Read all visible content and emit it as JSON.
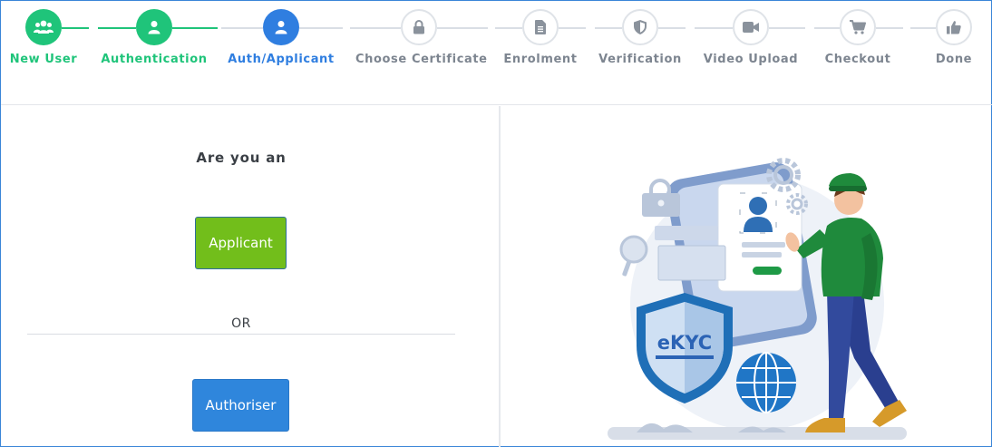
{
  "stepper": {
    "steps": [
      {
        "label": "New User",
        "state": "done",
        "icon": "users-icon"
      },
      {
        "label": "Authentication",
        "state": "done",
        "icon": "user-icon"
      },
      {
        "label": "Auth/Applicant",
        "state": "active",
        "icon": "user-icon"
      },
      {
        "label": "Choose Certificate",
        "state": "pending",
        "icon": "lock-icon"
      },
      {
        "label": "Enrolment",
        "state": "pending",
        "icon": "document-icon"
      },
      {
        "label": "Verification",
        "state": "pending",
        "icon": "shield-icon"
      },
      {
        "label": "Video Upload",
        "state": "pending",
        "icon": "video-camera-icon"
      },
      {
        "label": "Checkout",
        "state": "pending",
        "icon": "cart-icon"
      },
      {
        "label": "Done",
        "state": "pending",
        "icon": "thumbs-up-icon"
      }
    ]
  },
  "role_select": {
    "question": "Are you an",
    "applicant_label": "Applicant",
    "or_label": "OR",
    "authoriser_label": "Authoriser"
  },
  "illustration": {
    "badge_text": "eKYC"
  },
  "colors": {
    "done": "#1fc47a",
    "active": "#2f7ee0",
    "pending_text": "#7d8590",
    "applicant_button": "#72be1b",
    "authoriser_button": "#2f86dc"
  }
}
